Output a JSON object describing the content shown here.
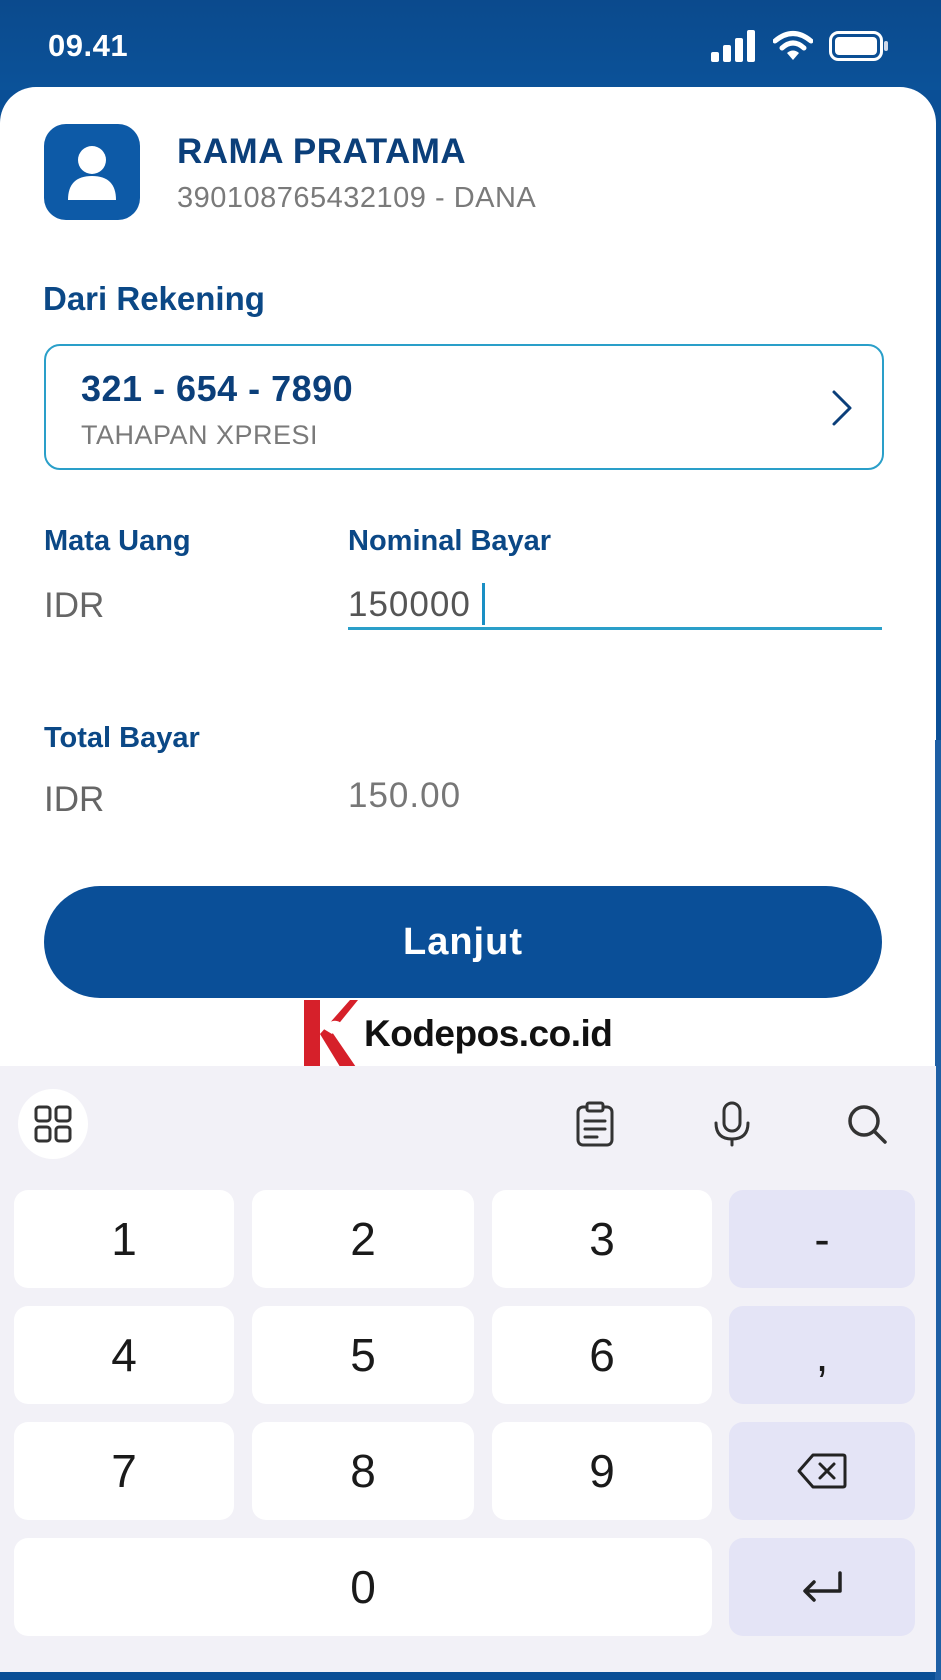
{
  "status_bar": {
    "time": "09.41",
    "icons": [
      "signal-icon",
      "wifi-icon",
      "battery-icon"
    ]
  },
  "recipient": {
    "name": "RAMA PRATAMA",
    "account": "390108765432109 - DANA",
    "icon": "user-icon"
  },
  "from_account": {
    "label": "Dari Rekening",
    "number": "321 - 654 - 7890",
    "type": "TAHAPAN XPRESI",
    "icon": "chevron-right-icon"
  },
  "currency": {
    "label": "Mata Uang",
    "value": "IDR"
  },
  "amount": {
    "label": "Nominal Bayar",
    "value": "150000"
  },
  "total": {
    "label": "Total Bayar",
    "currency": "IDR",
    "value": "150.00"
  },
  "continue_button": {
    "label": "Lanjut"
  },
  "watermark": {
    "text": "Kodepos.co.id"
  },
  "keyboard": {
    "toolbar_icons": [
      "apps-grid-icon",
      "clipboard-icon",
      "microphone-icon",
      "search-icon"
    ],
    "keys": {
      "k1": "1",
      "k2": "2",
      "k3": "3",
      "minus": "-",
      "k4": "4",
      "k5": "5",
      "k6": "6",
      "comma": ",",
      "k7": "7",
      "k8": "8",
      "k9": "9",
      "k0": "0"
    },
    "special_icons": [
      "backspace-icon",
      "enter-icon"
    ]
  },
  "colors": {
    "brand": "#0a4f98",
    "accent": "#2a9fc9",
    "heading": "#0b4886"
  }
}
